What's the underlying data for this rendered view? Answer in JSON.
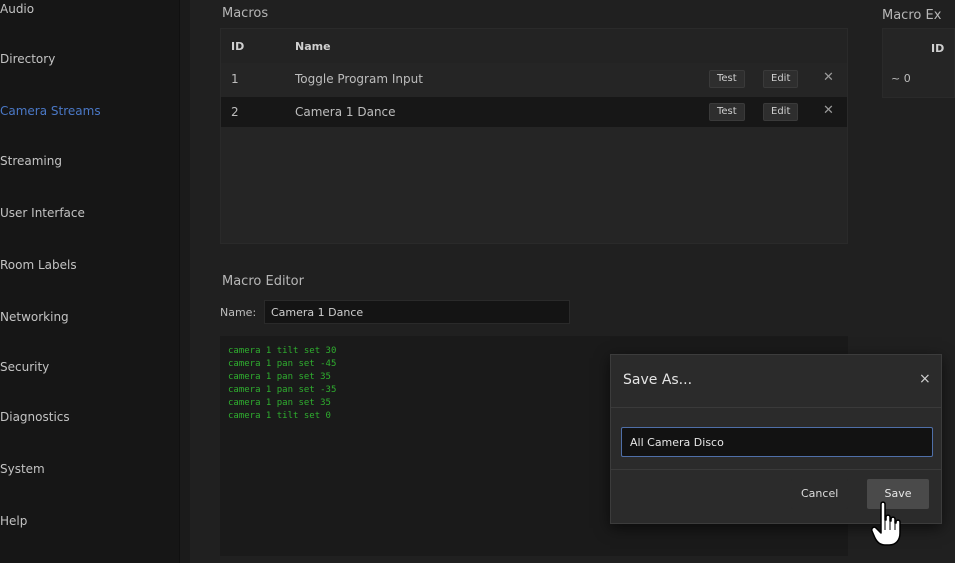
{
  "sidebar": {
    "items": [
      {
        "label": "Audio"
      },
      {
        "label": "Directory"
      },
      {
        "label": "Camera Streams",
        "active": true
      },
      {
        "label": "Streaming"
      },
      {
        "label": "User Interface"
      },
      {
        "label": "Room Labels"
      },
      {
        "label": "Networking"
      },
      {
        "label": "Security"
      },
      {
        "label": "Diagnostics"
      },
      {
        "label": "System"
      },
      {
        "label": "Help"
      }
    ]
  },
  "macros": {
    "title": "Macros",
    "header": {
      "id": "ID",
      "name": "Name"
    },
    "rows": [
      {
        "id": "1",
        "name": "Toggle Program Input",
        "test": "Test",
        "edit": "Edit"
      },
      {
        "id": "2",
        "name": "Camera 1 Dance",
        "test": "Test",
        "edit": "Edit"
      }
    ]
  },
  "macro_editor": {
    "title": "Macro Editor",
    "name_label": "Name:",
    "name_value": "Camera 1 Dance",
    "code": [
      "camera 1 tilt set 30",
      "camera 1 pan set -45",
      "camera 1 pan set 35",
      "camera 1 pan set -35",
      "camera 1 pan set 35",
      "camera 1 tilt set 0"
    ]
  },
  "macro_exec": {
    "title": "Macro Ex",
    "header_id": "ID",
    "row": "~ 0"
  },
  "dialog": {
    "title": "Save As...",
    "close": "×",
    "input_value": "All Camera Disco",
    "cancel": "Cancel",
    "save": "Save"
  },
  "colors": {
    "active_nav": "#4a78c6",
    "code_text": "#2fae2f",
    "input_focus": "#4f6fa8"
  }
}
